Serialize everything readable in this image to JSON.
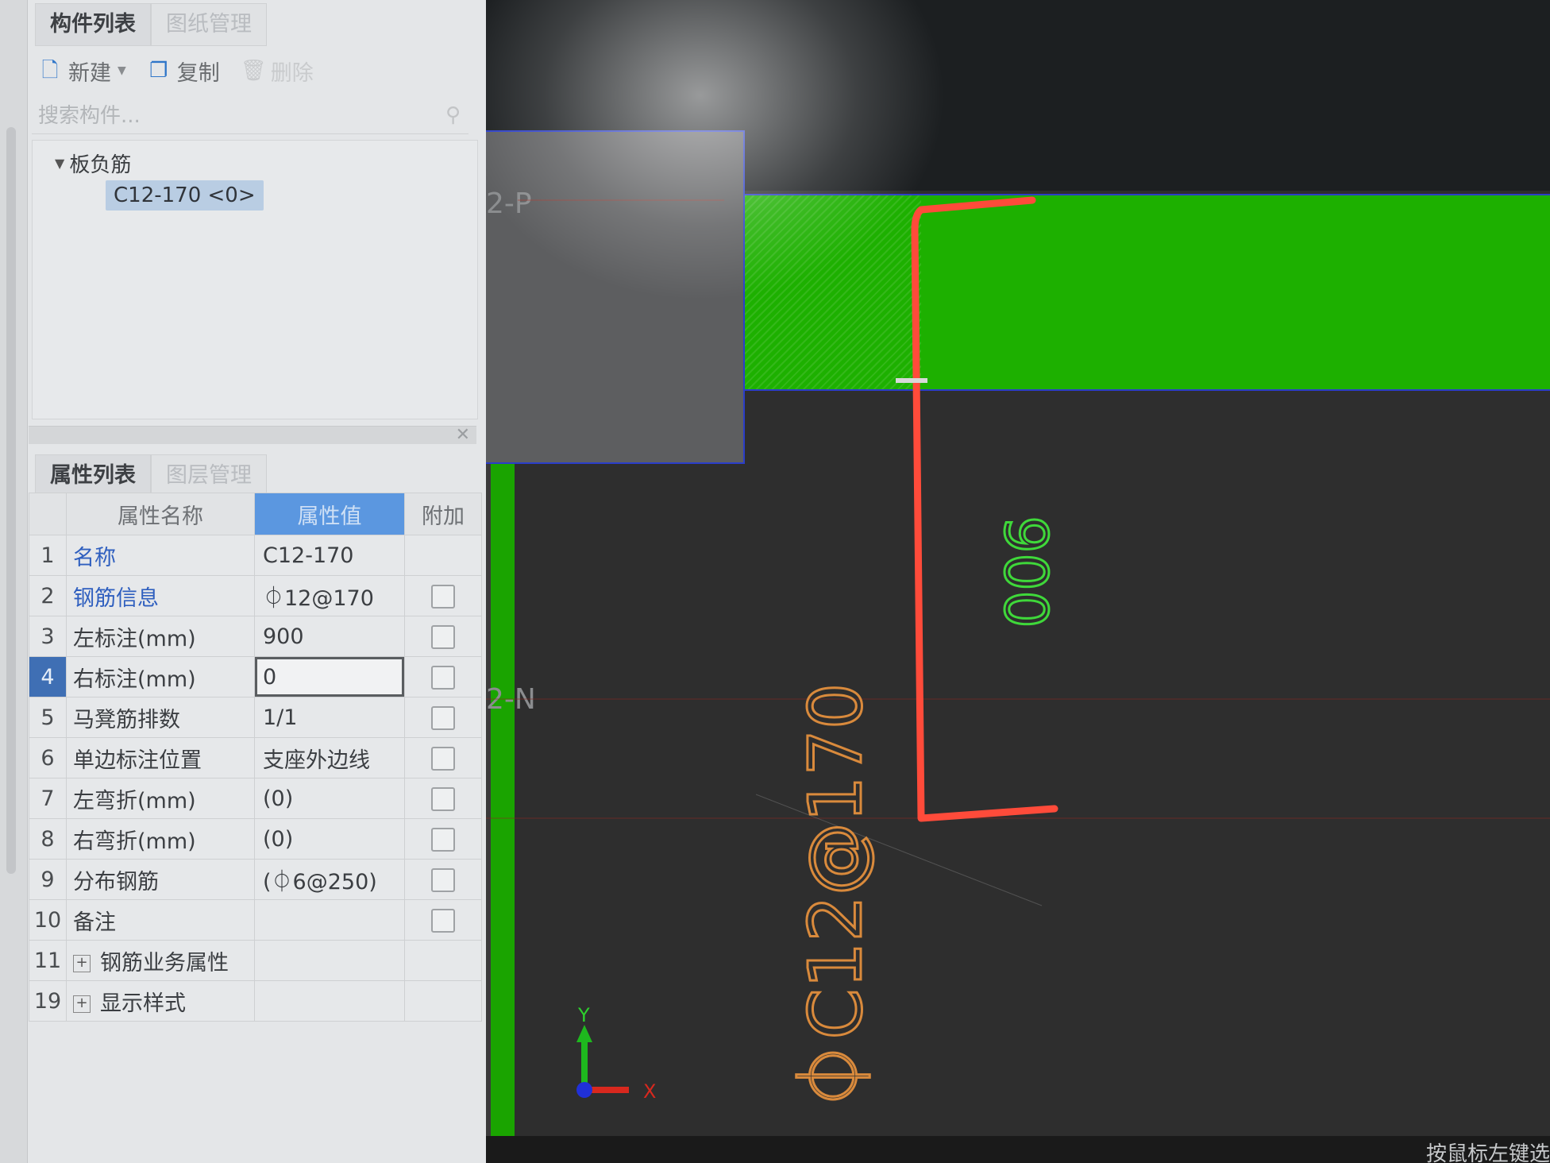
{
  "top_tabs": {
    "components": "构件列表",
    "drawings": "图纸管理"
  },
  "toolbar": {
    "new": "新建",
    "copy": "复制",
    "delete": "删除"
  },
  "search": {
    "placeholder": "搜索构件..."
  },
  "tree": {
    "group": "板负筋",
    "item": "C12-170 <0>"
  },
  "bottom_tabs": {
    "properties": "属性列表",
    "layers": "图层管理"
  },
  "props_header": {
    "name": "属性名称",
    "value": "属性值",
    "extra": "附加"
  },
  "props": {
    "r1": {
      "num": "1",
      "name": "名称",
      "value": "C12-170"
    },
    "r2": {
      "num": "2",
      "name": "钢筋信息",
      "value": "⏀12@170"
    },
    "r3": {
      "num": "3",
      "name": "左标注(mm)",
      "value": "900"
    },
    "r4": {
      "num": "4",
      "name": "右标注(mm)",
      "value": "0"
    },
    "r5": {
      "num": "5",
      "name": "马凳筋排数",
      "value": "1/1"
    },
    "r6": {
      "num": "6",
      "name": "单边标注位置",
      "value": "支座外边线"
    },
    "r7": {
      "num": "7",
      "name": "左弯折(mm)",
      "value": "(0)"
    },
    "r8": {
      "num": "8",
      "name": "右弯折(mm)",
      "value": "(0)"
    },
    "r9": {
      "num": "9",
      "name": "分布钢筋",
      "value": "(⏀6@250)"
    },
    "r10": {
      "num": "10",
      "name": "备注",
      "value": ""
    },
    "r11": {
      "num": "11",
      "name": "钢筋业务属性"
    },
    "r19": {
      "num": "19",
      "name": "显示样式"
    }
  },
  "canvas": {
    "axis_p": "2-P",
    "axis_n": "2-N",
    "dim_text": "900",
    "rebar_text": "⏀C12@170",
    "axis_y": "Y",
    "axis_x": "X",
    "status": "按鼠标左键选"
  },
  "colors": {
    "slab_green": "#1db000",
    "annotation_red": "#ff4b3a",
    "dim_green": "#3fd83a",
    "rebar_orange": "#d98a3c",
    "selection_blue": "#5b97e0"
  }
}
